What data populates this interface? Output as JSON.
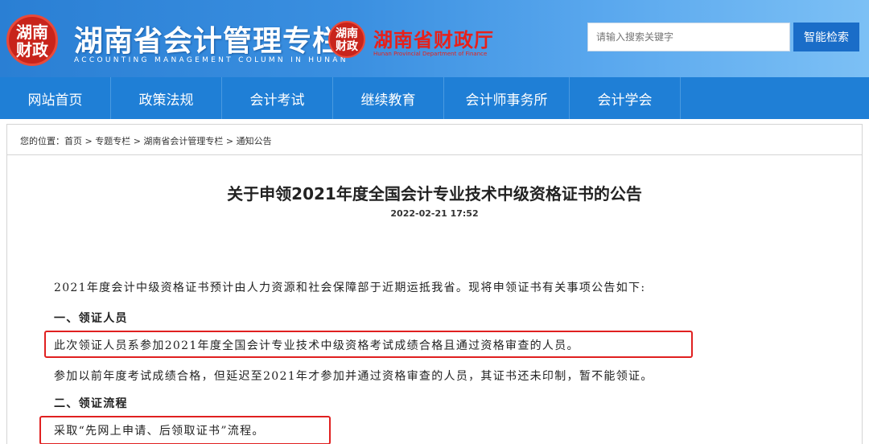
{
  "header": {
    "seal_text": "湖南财政",
    "title": "湖南省会计管理专栏",
    "subtitle": "ACCOUNTING MANAGEMENT COLUMN IN HUNAN",
    "dept_seal_text": "湖南财政",
    "dept_name": "湖南省财政厅",
    "dept_en": "Hunan Provincial Department of Finance",
    "search_placeholder": "请输入搜索关键字",
    "search_button": "智能检索"
  },
  "nav": [
    "网站首页",
    "政策法规",
    "会计考试",
    "继续教育",
    "会计师事务所",
    "会计学会"
  ],
  "breadcrumb": "您的位置：首页 > 专题专栏 > 湖南省会计管理专栏 > 通知公告",
  "article": {
    "title": "关于申领2021年度全国会计专业技术中级资格证书的公告",
    "date": "2022-02-21 17:52",
    "paragraphs": [
      "2021年度会计中级资格证书预计由人力资源和社会保障部于近期运抵我省。现将申领证书有关事项公告如下:",
      "一、领证人员",
      "此次领证人员系参加2021年度全国会计专业技术中级资格考试成绩合格且通过资格审查的人员。",
      "参加以前年度考试成绩合格，但延迟至2021年才参加并通过资格审查的人员，其证书还未印制，暂不能领证。",
      "二、领证流程",
      "采取“先网上申请、后领取证书”流程。"
    ]
  },
  "colors": {
    "nav_bg": "#1f7fd6",
    "highlight": "#e02020",
    "dept_red": "#e8201a"
  }
}
